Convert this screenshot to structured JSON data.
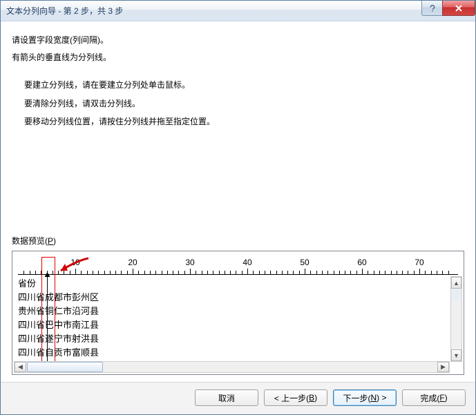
{
  "title": "文本分列向导 - 第 2 步，共 3 步",
  "intro": {
    "line1": "请设置字段宽度(列间隔)。",
    "line2": "有箭头的垂直线为分列线。"
  },
  "bullets": {
    "b1": "要建立分列线，请在要建立分列处单击鼠标。",
    "b2": "要清除分列线，请双击分列线。",
    "b3": "要移动分列线位置，请按住分列线并拖至指定位置。"
  },
  "preview": {
    "label_prefix": "数据预览(",
    "label_key": "P",
    "label_suffix": ")",
    "ruler_ticks": [
      10,
      20,
      30,
      40,
      50,
      60,
      70
    ],
    "rows": [
      "省份",
      "四川省成都市彭州区",
      "贵州省铜仁市沿河县",
      "四川省巴中市南江县",
      "四川省遂宁市射洪县",
      "四川省自贡市富顺县"
    ]
  },
  "buttons": {
    "cancel": "取消",
    "back_prefix": "< 上一步(",
    "back_key": "B",
    "back_suffix": ")",
    "next_prefix": "下一步(",
    "next_key": "N",
    "next_suffix": ") >",
    "finish_prefix": "完成(",
    "finish_key": "F",
    "finish_suffix": ")"
  }
}
